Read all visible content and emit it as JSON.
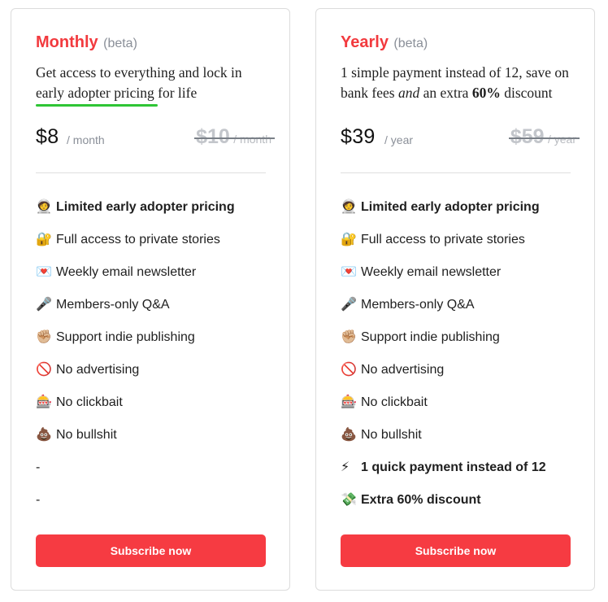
{
  "plans": {
    "monthly": {
      "name": "Monthly",
      "beta": "(beta)",
      "description": "Get access to everything and lock in early adopter pricing for life",
      "price": "$8",
      "period": "/ month",
      "old_price": "$10",
      "old_period": "/ month",
      "features": [
        {
          "emoji": "🧑‍🚀",
          "icon": "astronaut-icon",
          "label": "Limited early adopter pricing",
          "bold": true
        },
        {
          "emoji": "🔐",
          "icon": "lock-icon",
          "label": "Full access to private stories",
          "bold": false
        },
        {
          "emoji": "💌",
          "icon": "love-letter-icon",
          "label": "Weekly email newsletter",
          "bold": false
        },
        {
          "emoji": "🎤",
          "icon": "microphone-icon",
          "label": "Members-only Q&A",
          "bold": false
        },
        {
          "emoji": "✊🏼",
          "icon": "raised-fist-icon",
          "label": "Support indie publishing",
          "bold": false
        },
        {
          "emoji": "🚫",
          "icon": "prohibited-icon",
          "label": "No advertising",
          "bold": false
        },
        {
          "emoji": "🎰",
          "icon": "slot-machine-icon",
          "label": "No clickbait",
          "bold": false
        },
        {
          "emoji": "💩",
          "icon": "poop-icon",
          "label": "No bullshit",
          "bold": false
        },
        {
          "emoji": "",
          "icon": "",
          "label": "-",
          "bold": false
        },
        {
          "emoji": "",
          "icon": "",
          "label": "-",
          "bold": false
        }
      ],
      "cta": "Subscribe now"
    },
    "yearly": {
      "name": "Yearly",
      "beta": "(beta)",
      "description_parts": {
        "part1": "1 simple payment instead of 12, save on bank fees ",
        "emph": "and",
        "part2": " an extra ",
        "strong": "60%",
        "part3": " discount"
      },
      "price": "$39",
      "period": "/ year",
      "old_price": "$59",
      "old_period": "/ year",
      "features": [
        {
          "emoji": "🧑‍🚀",
          "icon": "astronaut-icon",
          "label": "Limited early adopter pricing",
          "bold": true
        },
        {
          "emoji": "🔐",
          "icon": "lock-icon",
          "label": "Full access to private stories",
          "bold": false
        },
        {
          "emoji": "💌",
          "icon": "love-letter-icon",
          "label": "Weekly email newsletter",
          "bold": false
        },
        {
          "emoji": "🎤",
          "icon": "microphone-icon",
          "label": "Members-only Q&A",
          "bold": false
        },
        {
          "emoji": "✊🏼",
          "icon": "raised-fist-icon",
          "label": "Support indie publishing",
          "bold": false
        },
        {
          "emoji": "🚫",
          "icon": "prohibited-icon",
          "label": "No advertising",
          "bold": false
        },
        {
          "emoji": "🎰",
          "icon": "slot-machine-icon",
          "label": "No clickbait",
          "bold": false
        },
        {
          "emoji": "💩",
          "icon": "poop-icon",
          "label": "No bullshit",
          "bold": false
        },
        {
          "emoji": "⚡",
          "icon": "lightning-icon",
          "label": "1 quick payment instead of 12",
          "bold": true
        },
        {
          "emoji": "💸",
          "icon": "money-wings-icon",
          "label": "Extra 60% discount",
          "bold": true
        }
      ],
      "cta": "Subscribe now"
    }
  },
  "colors": {
    "accent": "#f23a3e",
    "button": "#f63b42",
    "highlight_underline": "#2ec535",
    "muted": "#8a8f98"
  }
}
